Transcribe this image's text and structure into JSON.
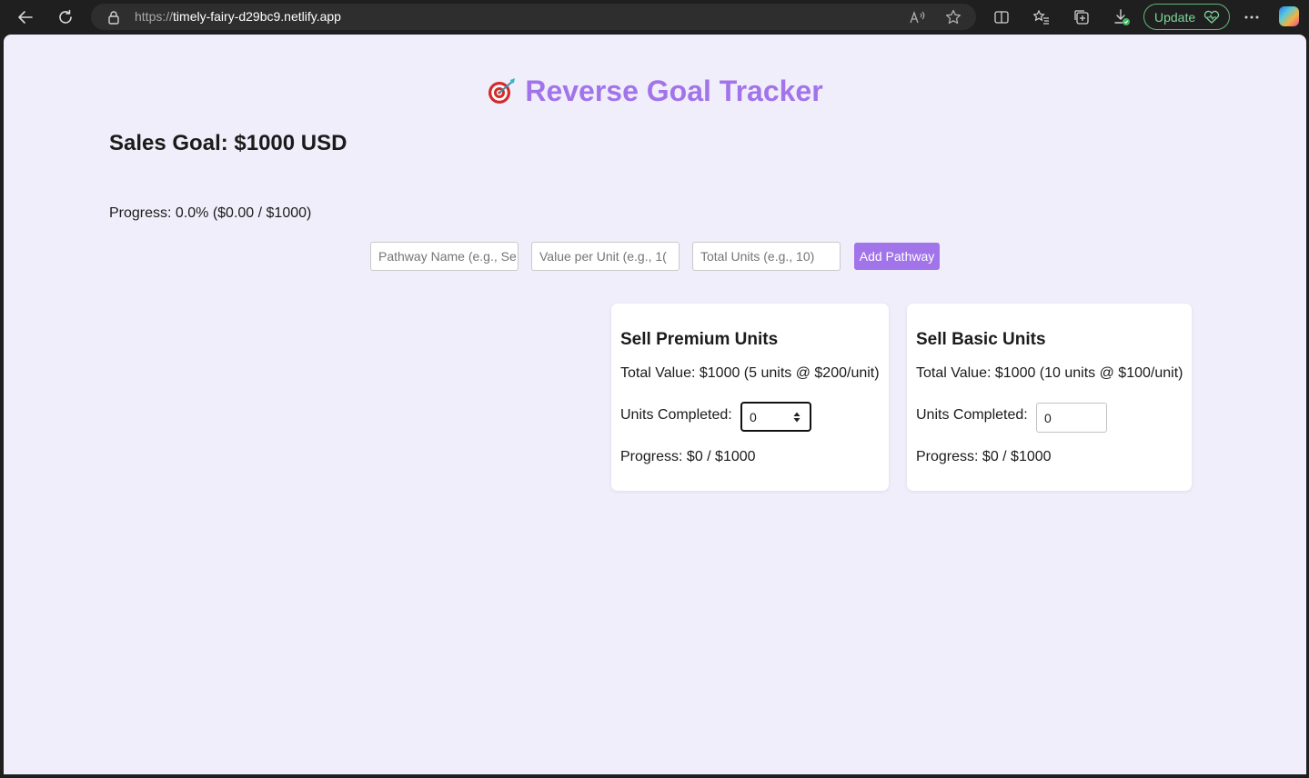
{
  "browser": {
    "url_protocol": "https://",
    "url_host": "timely-fairy-d29bc9.netlify.app",
    "update_label": "Update"
  },
  "app": {
    "title": "Reverse Goal Tracker",
    "goal_heading": "Sales Goal: $1000 USD",
    "progress_text": "Progress: 0.0% ($0.00 / $1000)",
    "accent_color": "#a274ea"
  },
  "form": {
    "name_placeholder": "Pathway Name (e.g., Se",
    "value_placeholder": "Value per Unit (e.g., 1(",
    "units_placeholder": "Total Units (e.g., 10)",
    "add_label": "Add Pathway"
  },
  "pathways": [
    {
      "title": "Sell Premium Units",
      "total_value": "Total Value: $1000 (5 units @ $200/unit)",
      "units_label": "Units Completed:",
      "units_value": "0",
      "progress": "Progress: $0 / $1000"
    },
    {
      "title": "Sell Basic Units",
      "total_value": "Total Value: $1000 (10 units @ $100/unit)",
      "units_label": "Units Completed:",
      "units_value": "0",
      "progress": "Progress: $0 / $1000"
    }
  ]
}
